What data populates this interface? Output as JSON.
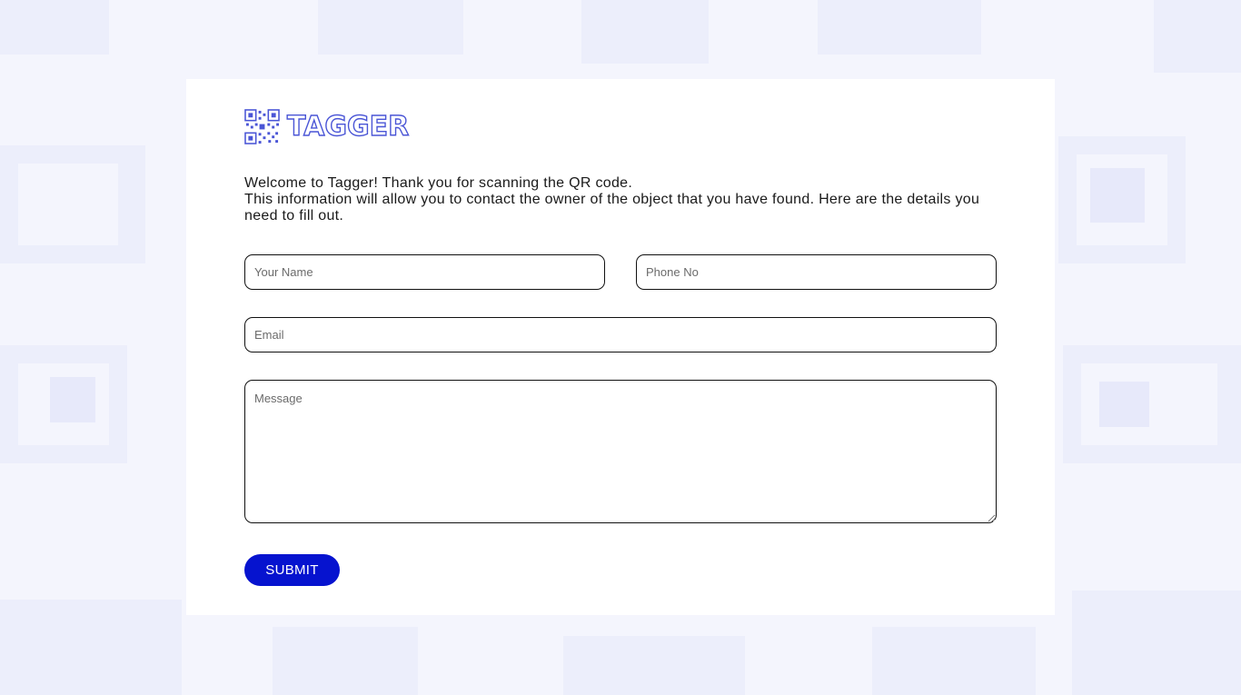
{
  "background": {
    "color": "#f4f5fd",
    "pattern_color": "#eceefb",
    "pattern_icon": "qr-code-pattern"
  },
  "logo": {
    "icon": "qr-code-icon",
    "text": "TAGGER",
    "color": "#4a55d6"
  },
  "intro": {
    "line1": "Welcome to Tagger! Thank you for scanning the QR code.",
    "line2": "This information will allow you to contact the owner of the object that you have found. Here are the details you need to fill out."
  },
  "form": {
    "name_placeholder": "Your Name",
    "phone_placeholder": "Phone No",
    "email_placeholder": "Email",
    "message_placeholder": "Message",
    "submit_label": "SUBMIT",
    "submit_color": "#0613cf"
  }
}
